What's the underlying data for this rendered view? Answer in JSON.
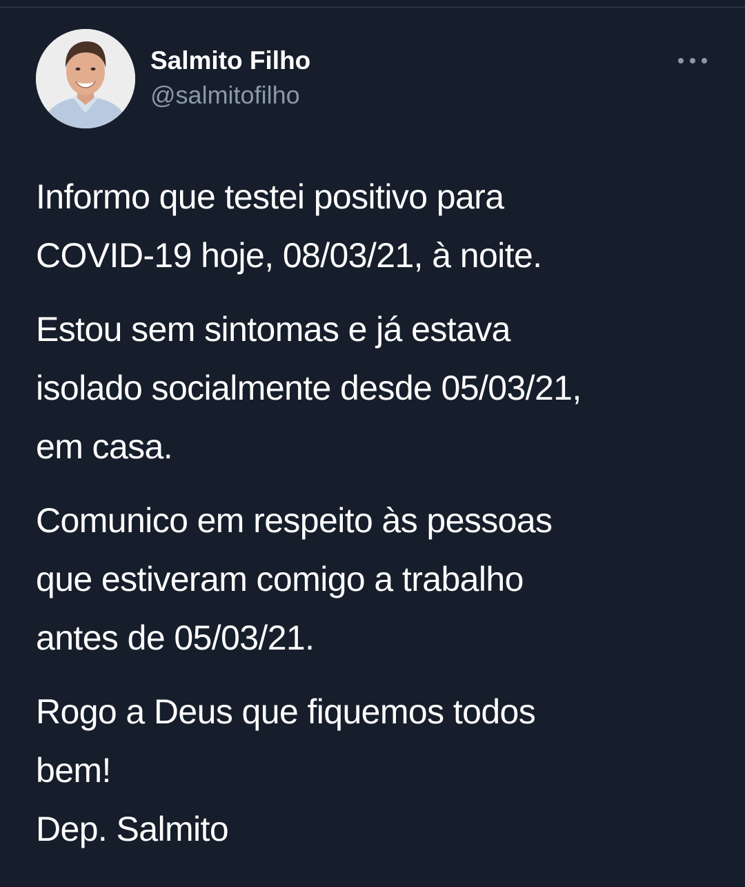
{
  "tweet": {
    "author": {
      "display_name": "Salmito Filho",
      "handle": "@salmitofilho",
      "avatar_icon": "profile-photo"
    },
    "more_icon": "more-horizontal-icon",
    "paragraphs": [
      "Informo que testei positivo para\nCOVID-19 hoje, 08/03/21, à noite.",
      "Estou sem sintomas e já estava\nisolado  socialmente desde 05/03/21,\nem casa.",
      "Comunico em respeito às pessoas\nque estiveram comigo a trabalho\nantes de 05/03/21.",
      "Rogo a Deus que fiquemos todos\nbem!\nDep. Salmito"
    ]
  },
  "colors": {
    "background": "#161e2b",
    "text_primary": "#ffffff",
    "text_secondary": "#8b98a5"
  }
}
